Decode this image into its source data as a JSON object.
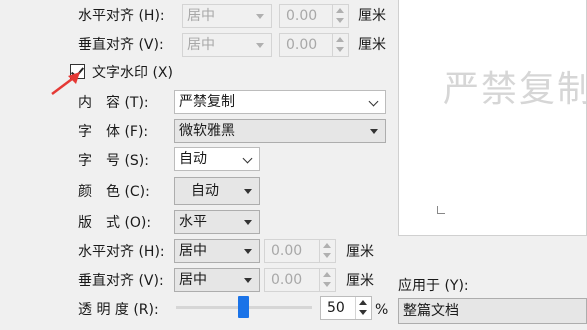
{
  "wm_settings": {
    "halign_label": "水平对齐 (H):",
    "valign_label": "垂直对齐 (V):",
    "halign_value": "居中",
    "valign_value": "居中",
    "offset_h": "0.00",
    "offset_v": "0.00",
    "unit": "厘米"
  },
  "text_watermark": {
    "checkbox_label": "文字水印 (X)",
    "checked": true,
    "content_label": "内　容 (T):",
    "content_value": "严禁复制",
    "font_label": "字　体 (F):",
    "font_value": "微软雅黑",
    "size_label": "字　号 (S):",
    "size_value": "自动",
    "color_label": "颜　色 (C):",
    "color_value": "自动",
    "layout_label": "版　式 (O):",
    "layout_value": "水平",
    "halign_label": "水平对齐 (H):",
    "halign_value": "居中",
    "halign_offset": "0.00",
    "valign_label": "垂直对齐 (V):",
    "valign_value": "居中",
    "valign_offset": "0.00",
    "unit": "厘米",
    "transparency_label": "透 明 度 (R):",
    "transparency_value": "50",
    "transparency_unit": "%",
    "transparency_level": 0.5
  },
  "apply_to": {
    "label": "应用于 (Y):",
    "value": "整篇文档"
  },
  "preview": {
    "watermark_text": "严禁复制"
  },
  "colors": {
    "slider_thumb": "#1a73e8",
    "annotation_arrow": "#e53935"
  }
}
